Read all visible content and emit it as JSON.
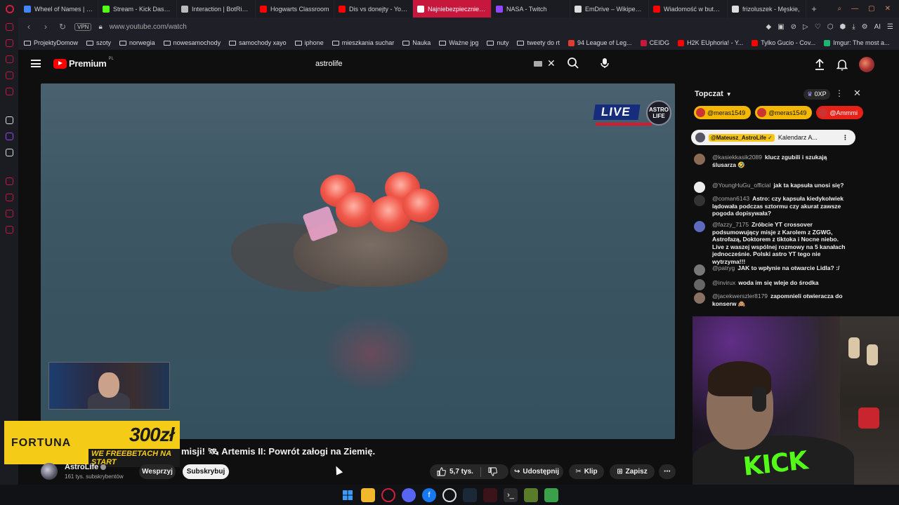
{
  "browser": {
    "tabs": [
      {
        "label": "Wheel of Names | Ran",
        "color": "#4285f4",
        "active": false
      },
      {
        "label": "Stream - Kick Dashbo",
        "color": "#53fc18",
        "active": false
      },
      {
        "label": "Interaction | BotRix —",
        "color": "#bbbbbb",
        "active": false
      },
      {
        "label": "Hogwarts Classroom",
        "color": "#ff0000",
        "active": false
      },
      {
        "label": "Dis vs donejty - YouT",
        "color": "#ff0000",
        "active": false
      },
      {
        "label": "Najniebezpieczniejszy",
        "color": "#ffffff",
        "active": true
      },
      {
        "label": "NASA - Twitch",
        "color": "#9146ff",
        "active": false
      },
      {
        "label": "EmDrive – Wikipedia,",
        "color": "#dddddd",
        "active": false
      },
      {
        "label": "Wiadomość w butelce",
        "color": "#ff0000",
        "active": false
      },
      {
        "label": "frizoluszek - Męskie,",
        "color": "#dddddd",
        "active": false
      }
    ],
    "new_tab": "+",
    "vpn": "VPN",
    "url": "www.youtube.com/watch",
    "ai_label": "AI",
    "bookmarks": [
      {
        "label": "ProjektyDomow",
        "type": "folder"
      },
      {
        "label": "szoty",
        "type": "folder"
      },
      {
        "label": "norwegia",
        "type": "folder"
      },
      {
        "label": "nowesamochody",
        "type": "folder"
      },
      {
        "label": "samochody xayo",
        "type": "folder"
      },
      {
        "label": "iphone",
        "type": "folder"
      },
      {
        "label": "mieszkania suchar",
        "type": "folder"
      },
      {
        "label": "Nauka",
        "type": "folder"
      },
      {
        "label": "Ważne jpg",
        "type": "folder"
      },
      {
        "label": "nuty",
        "type": "folder"
      },
      {
        "label": "tweety do rt",
        "type": "folder"
      },
      {
        "label": "94 League of Leg...",
        "type": "site",
        "color": "#e03c31"
      },
      {
        "label": "CEIDG",
        "type": "site",
        "color": "#c8173d"
      },
      {
        "label": "H2K EUphoria! - Y...",
        "type": "site",
        "color": "#ff0000"
      },
      {
        "label": "Tylko Gucio - Cov...",
        "type": "site",
        "color": "#ff0000"
      },
      {
        "label": "Imgur: The most a...",
        "type": "site",
        "color": "#1bb76e"
      }
    ]
  },
  "youtube": {
    "logo_text": "Premium",
    "logo_region": "PL",
    "search_value": "astrolife",
    "video": {
      "title": "misji! 🛰 Artemis II: Powrót załogi na Ziemię.",
      "live_text": "LIVE",
      "live_logo_line1": "ASTRO",
      "live_logo_line2": "LIFE"
    },
    "channel": {
      "name": "AstroLife",
      "subscribers": "161 tys. subskrybentów",
      "support_label": "Wesprzyj",
      "subscribe_label": "Subskrybuj"
    },
    "actions": {
      "likes": "5,7 tys.",
      "share": "Udostępnij",
      "clip": "Klip",
      "save": "Zapisz"
    },
    "overlay_ad": {
      "brand": "FORTUNA",
      "amount": "300zł",
      "tagline": "WE FREEBETACH NA START"
    }
  },
  "chat": {
    "title": "Topczat",
    "xp": "0XP",
    "donors": [
      {
        "name": "@meras1549",
        "style": "gold"
      },
      {
        "name": "@meras1549",
        "style": "gold"
      },
      {
        "name": "@Ammmi",
        "style": "red"
      }
    ],
    "pinned": {
      "author": "@Mateusz_AstroLife ✓",
      "text": "Kalendarz A..."
    },
    "messages": [
      {
        "user": "@kasiekkasik2089",
        "text": "klucz zgubili i szukają ślusarza 🤣",
        "color": "#8a6a55"
      },
      {
        "user": "@YoungHuGu_official",
        "text": "jak ta kapsuła unosi się?",
        "color": "#ececec"
      },
      {
        "user": "@coman6143",
        "text": "Astro: czy kapsuła kiedykolwiek lądowała podczas sztormu czy akurat zawsze pogoda dopisywała?",
        "color": "#333333"
      },
      {
        "user": "@fazzy_7175",
        "text": "Zróbcie YT crossover podsumowujący misje z Karolem z ZGWG, Astrofazą, Doktorem z tiktoka i Nocne niebo. Live z waszej wspólnej rozmowy na 5 kanałach jednocześnie. Polski astro YT tego nie wytrzyma!!!",
        "color": "#5c6bc0"
      },
      {
        "user": "@patryg",
        "text": "JAK to wpłynie na otwarcie Lidla? :/",
        "color": "#777777"
      },
      {
        "user": "@invirux",
        "text": "woda im się wleje do środka",
        "color": "#666666"
      },
      {
        "user": "@jacekwerszler8179",
        "text": "zapomnieli otwieracza do konserw 🙈",
        "color": "#8a7060"
      }
    ]
  },
  "streamer_cam": {
    "shirt_text": "KICK"
  }
}
